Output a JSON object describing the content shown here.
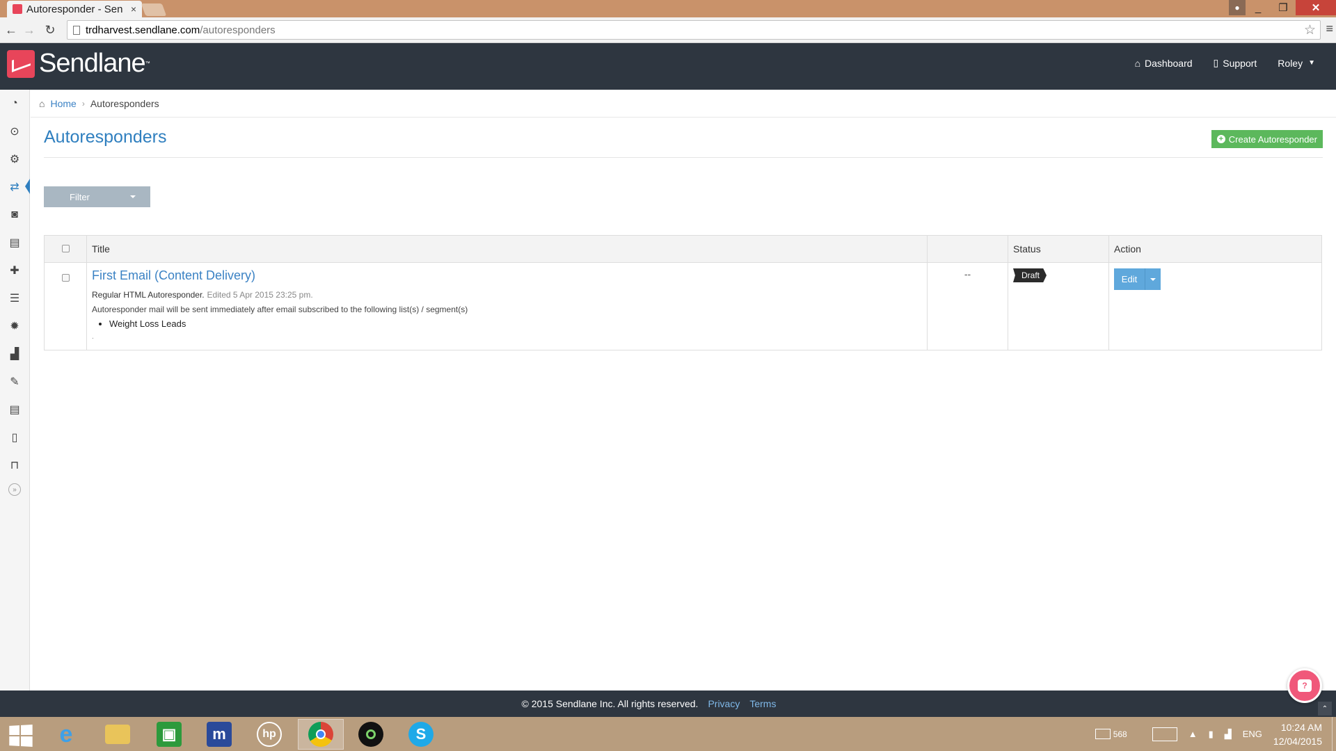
{
  "browser": {
    "tab_title": "Autoresponder - Sen",
    "tab_close": "×",
    "url_host": "trdharvest.sendlane.com",
    "url_path": "/autoresponders"
  },
  "header": {
    "brand": "Sendlane",
    "brand_tm": "™",
    "nav": [
      {
        "label": "Dashboard",
        "icon": "home-icon"
      },
      {
        "label": "Support",
        "icon": "mobile-icon"
      },
      {
        "label": "Roley",
        "icon": "caret-down-icon"
      }
    ]
  },
  "sidebar": {
    "items": [
      {
        "name": "dashboard-icon",
        "glyph": "◔"
      },
      {
        "name": "compass-icon",
        "glyph": "⊙"
      },
      {
        "name": "gears-icon",
        "glyph": "⚙"
      },
      {
        "name": "autoresponder-icon",
        "glyph": "⇄",
        "active": true
      },
      {
        "name": "rss-icon",
        "glyph": "◙"
      },
      {
        "name": "document-icon",
        "glyph": "▤"
      },
      {
        "name": "add-user-icon",
        "glyph": "✚"
      },
      {
        "name": "list-icon",
        "glyph": "☰"
      },
      {
        "name": "settings-icon",
        "glyph": "✹"
      },
      {
        "name": "signal-icon",
        "glyph": "▟"
      },
      {
        "name": "wrench-icon",
        "glyph": "✎"
      },
      {
        "name": "file-icon",
        "glyph": "▤"
      },
      {
        "name": "mobile-icon",
        "glyph": "▯"
      },
      {
        "name": "unlock-icon",
        "glyph": "⊓"
      }
    ],
    "expand_glyph": "»"
  },
  "breadcrumb": {
    "home": "Home",
    "separator": "›",
    "current": "Autoresponders"
  },
  "page": {
    "title": "Autoresponders",
    "create_button": "Create Autoresponder",
    "filter_button": "Filter"
  },
  "table": {
    "headers": {
      "title": "Title",
      "blank": "",
      "status": "Status",
      "action": "Action"
    },
    "rows": [
      {
        "title": "First Email (Content Delivery)",
        "type": "Regular HTML Autoresponder.",
        "edited": "Edited 5 Apr 2015 23:25 pm.",
        "description": "Autoresponder mail will be sent immediately after email subscribed to the following list(s) / segment(s)",
        "lists": [
          "Weight Loss Leads"
        ],
        "trailing": ".",
        "dash": "--",
        "status": "Draft",
        "action": "Edit"
      }
    ]
  },
  "footer": {
    "copyright": "© 2015 Sendlane Inc. All rights reserved.",
    "privacy": "Privacy",
    "terms": "Terms"
  },
  "taskbar": {
    "apps": [
      "ie-icon",
      "file-explorer-icon",
      "store-icon",
      "m-app-icon",
      "hp-icon",
      "chrome-icon",
      "camera-app-icon",
      "skype-icon"
    ],
    "mail_count": "568",
    "language": "ENG",
    "time": "10:24 AM",
    "date": "12/04/2015"
  },
  "colors": {
    "header_bg": "#2e3640",
    "brand": "#e8455a",
    "link": "#3b82c4",
    "create_button": "#5cb85c",
    "edit_button": "#5fa8dc",
    "filter_button": "#a9b7c2"
  }
}
